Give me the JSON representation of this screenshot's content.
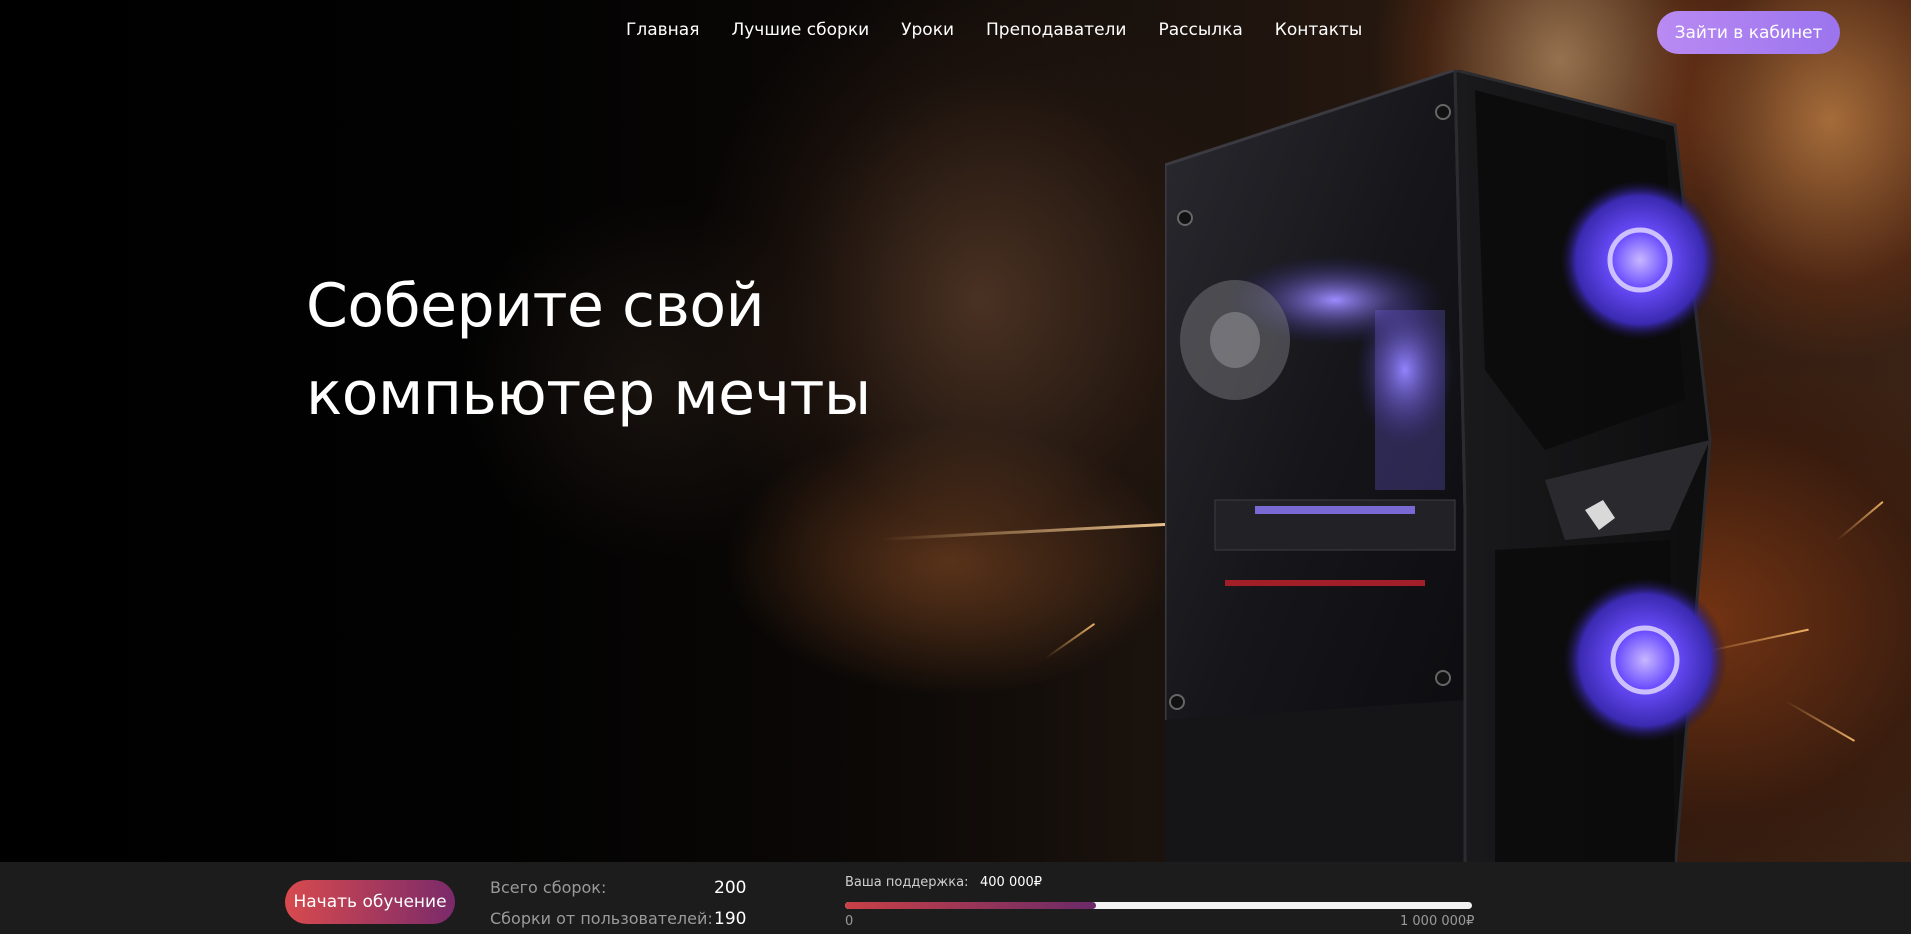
{
  "nav": {
    "items": [
      {
        "label": "Главная"
      },
      {
        "label": "Лучшие сборки"
      },
      {
        "label": "Уроки"
      },
      {
        "label": "Преподаватели"
      },
      {
        "label": "Рассылка"
      },
      {
        "label": "Контакты"
      }
    ],
    "login_label": "Зайти в кабинет"
  },
  "hero": {
    "title_line1": "Соберите свой",
    "title_line2": "компьютер мечты"
  },
  "bottom_bar": {
    "start_label": "Начать обучение",
    "total_label": "Всего сборок:",
    "total_value": "200",
    "user_label": "Сборки от пользователей:",
    "user_value": "190",
    "support_label": "Ваша поддержка:",
    "support_value": "400 000₽",
    "scale_min": "0",
    "scale_max": "1 000 000₽",
    "support_fraction": 0.4
  },
  "colors": {
    "login_button": "#9b74ee",
    "start_button": "#d84a4e",
    "progress_fill": "#c94046",
    "bar_background": "#1c1c1c"
  }
}
